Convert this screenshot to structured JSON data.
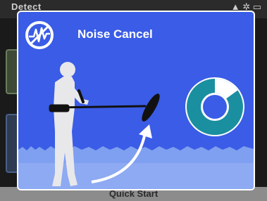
{
  "background_app": {
    "header_title": "Detect",
    "bottom_label": "Quick Start"
  },
  "dialog": {
    "title": "Noise Cancel",
    "icon": "noise-cancel-icon",
    "progress_fraction": 0.15
  },
  "colors": {
    "dialog_bg": "#3a5ce6",
    "ring_fill": "#1a8fa0",
    "ring_light": "#ffffff",
    "grass": "#7f9ff0"
  }
}
